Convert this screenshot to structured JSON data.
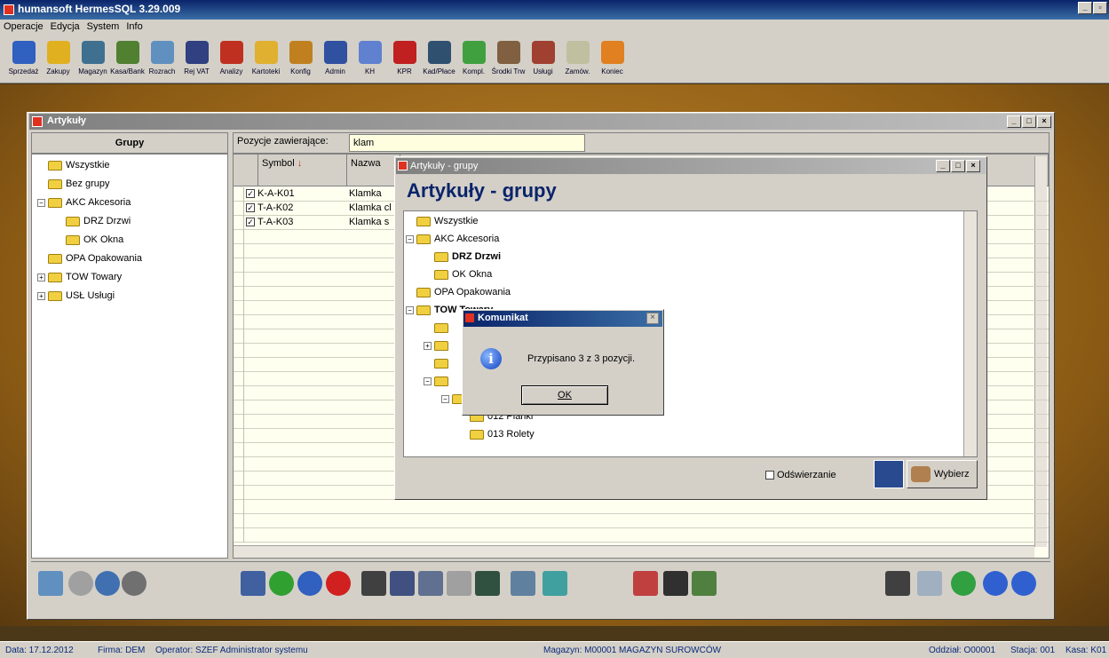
{
  "app": {
    "title": "humansoft HermesSQL 3.29.009"
  },
  "menu": [
    "Operacje",
    "Edycja",
    "System",
    "Info"
  ],
  "toolbar": [
    {
      "label": "Sprzedaż",
      "icon": "sales-icon",
      "color": "#3060c0"
    },
    {
      "label": "Zakupy",
      "icon": "cart-icon",
      "color": "#e0b020"
    },
    {
      "label": "Magazyn",
      "icon": "forklift-icon",
      "color": "#407090"
    },
    {
      "label": "Kasa/Bank",
      "icon": "money-bag-icon",
      "color": "#508030"
    },
    {
      "label": "Rozrach",
      "icon": "ledger-icon",
      "color": "#6090c0"
    },
    {
      "label": "Rej VAT",
      "icon": "vat-icon",
      "color": "#304080"
    },
    {
      "label": "Analizy",
      "icon": "pie-chart-icon",
      "color": "#c03020"
    },
    {
      "label": "Kartoteki",
      "icon": "folders-icon",
      "color": "#e0b030"
    },
    {
      "label": "Konfig",
      "icon": "gears-icon",
      "color": "#c08020"
    },
    {
      "label": "Admin",
      "icon": "admin-icon",
      "color": "#3050a0"
    },
    {
      "label": "KH",
      "icon": "ma-wn-icon",
      "color": "#6080d0"
    },
    {
      "label": "KPR",
      "icon": "kpr-icon",
      "color": "#c02020"
    },
    {
      "label": "Kad/Płace",
      "icon": "people-icon",
      "color": "#305070"
    },
    {
      "label": "Kompl.",
      "icon": "cube-icon",
      "color": "#40a040"
    },
    {
      "label": "Środki Trw",
      "icon": "truck-icon",
      "color": "#806040"
    },
    {
      "label": "Usługi",
      "icon": "worker-icon",
      "color": "#a04030"
    },
    {
      "label": "Zamów.",
      "icon": "clipboard-icon",
      "color": "#c0c0a0"
    },
    {
      "label": "Koniec",
      "icon": "exit-icon",
      "color": "#e08020"
    }
  ],
  "window": {
    "title": "Artykuły"
  },
  "groups": {
    "header": "Grupy",
    "items": [
      {
        "label": "Wszystkie",
        "level": 0,
        "expander": ""
      },
      {
        "label": "Bez grupy",
        "level": 0,
        "expander": ""
      },
      {
        "label": "AKC Akcesoria",
        "level": 0,
        "expander": "−"
      },
      {
        "label": "DRZ Drzwi",
        "level": 1,
        "expander": ""
      },
      {
        "label": "OK Okna",
        "level": 1,
        "expander": ""
      },
      {
        "label": "OPA Opakowania",
        "level": 0,
        "expander": ""
      },
      {
        "label": "TOW Towary",
        "level": 0,
        "expander": "+"
      },
      {
        "label": "USŁ Usługi",
        "level": 0,
        "expander": "+"
      }
    ]
  },
  "search": {
    "label": "Pozycje zawierające:",
    "value": "klam"
  },
  "table": {
    "headers": [
      "Symbol",
      "Nazwa"
    ],
    "rows": [
      {
        "symbol": "K-A-K01",
        "name": "Klamka",
        "checked": true
      },
      {
        "symbol": "T-A-K02",
        "name": "Klamka cl",
        "checked": true
      },
      {
        "symbol": "T-A-K03",
        "name": "Klamka s",
        "checked": true
      }
    ]
  },
  "dialog": {
    "title": "Artykuły - grupy",
    "heading": "Artykuły - grupy",
    "tree": [
      {
        "label": "Wszystkie",
        "level": 0,
        "expander": "",
        "bold": false
      },
      {
        "label": "AKC Akcesoria",
        "level": 0,
        "expander": "−",
        "bold": false
      },
      {
        "label": "DRZ Drzwi",
        "level": 1,
        "expander": "",
        "bold": true
      },
      {
        "label": "OK Okna",
        "level": 1,
        "expander": "",
        "bold": false
      },
      {
        "label": "OPA Opakowania",
        "level": 0,
        "expander": "",
        "bold": false
      },
      {
        "label": "TOW Towary",
        "level": 0,
        "expander": "−",
        "bold": true
      },
      {
        "label": "",
        "level": 1,
        "expander": "",
        "bold": false
      },
      {
        "label": "",
        "level": 1,
        "expander": "+",
        "bold": false
      },
      {
        "label": "",
        "level": 1,
        "expander": "",
        "bold": false
      },
      {
        "label": "",
        "level": 1,
        "expander": "−",
        "bold": true
      },
      {
        "label": "",
        "level": 2,
        "expander": "−",
        "bold": false
      },
      {
        "label": "012 Pianki",
        "level": 3,
        "expander": "",
        "bold": false
      },
      {
        "label": "013 Rolety",
        "level": 3,
        "expander": "",
        "bold": false
      }
    ],
    "refresh_label": "Odświerzanie",
    "select_label": "Wybierz"
  },
  "message": {
    "title": "Komunikat",
    "text": "Przypisano 3 z 3 pozycji.",
    "ok": "OK"
  },
  "status": {
    "date": "Data: 17.12.2012",
    "firm": "Firma: DEM",
    "operator": "Operator: SZEF Administrator systemu",
    "warehouse": "Magazyn: M00001 MAGAZYN SUROWCÓW",
    "branch": "Oddział: O00001",
    "station": "Stacja: 001",
    "cash": "Kasa: K01"
  }
}
